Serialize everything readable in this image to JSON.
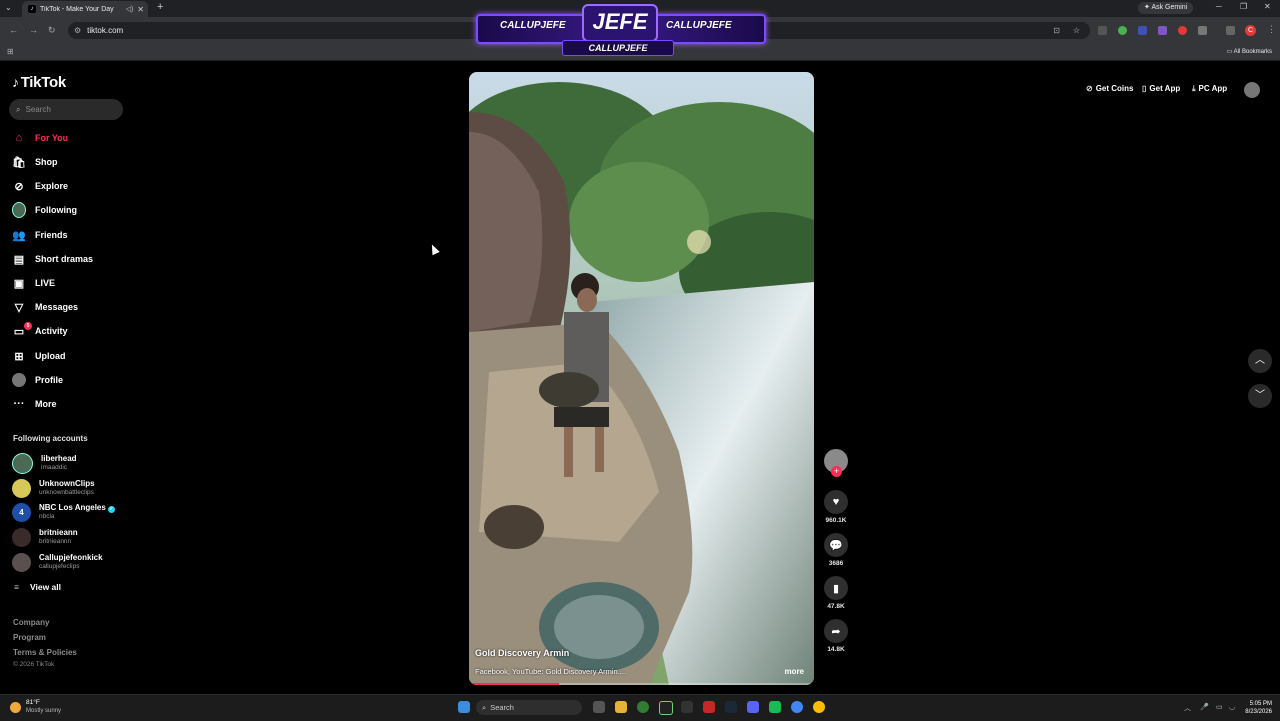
{
  "browser": {
    "tab_title": "TikTok - Make Your Day",
    "url": "tiktok.com",
    "gemini_label": "Ask Gemini",
    "all_bookmarks": "All Bookmarks",
    "profile_letter": "C"
  },
  "banner": {
    "left_handle": "CALLUPJEFE",
    "right_handle": "CALLUPJEFE",
    "center_text": "JEFE",
    "bottom_handle": "CALLUPJEFE"
  },
  "tiktok": {
    "logo_text": "TikTok",
    "search_placeholder": "Search",
    "nav": [
      {
        "label": "For You",
        "icon": "home-icon"
      },
      {
        "label": "Shop",
        "icon": "shopping-bag-icon"
      },
      {
        "label": "Explore",
        "icon": "compass-icon"
      },
      {
        "label": "Following",
        "icon": "following-avatar-icon"
      },
      {
        "label": "Friends",
        "icon": "friends-icon"
      },
      {
        "label": "Short dramas",
        "icon": "film-icon"
      },
      {
        "label": "LIVE",
        "icon": "live-icon"
      },
      {
        "label": "Messages",
        "icon": "send-icon"
      },
      {
        "label": "Activity",
        "icon": "activity-icon"
      },
      {
        "label": "Upload",
        "icon": "upload-icon"
      },
      {
        "label": "Profile",
        "icon": "profile-avatar-icon"
      },
      {
        "label": "More",
        "icon": "more-dots-icon"
      }
    ],
    "activity_badge": "5",
    "following_header": "Following accounts",
    "accounts": [
      {
        "name": "liberhead",
        "handle": "imaaddic"
      },
      {
        "name": "UnknownClips",
        "handle": "unknownbattleclips"
      },
      {
        "name": "NBC Los Angeles",
        "handle": "nbcla"
      },
      {
        "name": "britnieann",
        "handle": "britnieannn"
      },
      {
        "name": "Callupjefeonkick",
        "handle": "callupjefeclips"
      }
    ],
    "view_all": "View all",
    "footer": [
      "Company",
      "Program",
      "Terms & Policies"
    ],
    "copyright": "© 2026 TikTok",
    "top_right": {
      "coins": "Get Coins",
      "app": "Get App",
      "pc_app": "PC App"
    }
  },
  "video": {
    "author": "Gold Discovery Armin",
    "description": "Facebook, YouTube: Gold Discovery Armin....",
    "more": "more",
    "progress_percent": 26,
    "likes": "960.1K",
    "comments": "3686",
    "saves": "47.8K",
    "shares": "14.8K"
  },
  "taskbar": {
    "temp": "81°F",
    "condition": "Mostly sunny",
    "search_label": "Search",
    "time": "5:05 PM",
    "date": "8/23/2026"
  }
}
